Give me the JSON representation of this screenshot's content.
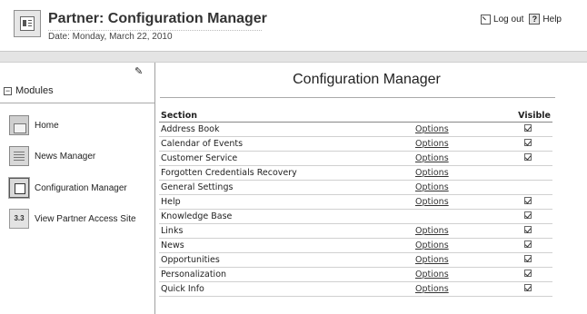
{
  "header": {
    "app_title": "Partner: Configuration Manager",
    "date": "Date: Monday, March 22, 2010",
    "logout_label": "Log out",
    "help_label": "Help"
  },
  "sidebar": {
    "modules_label": "Modules",
    "items": [
      {
        "label": "Home",
        "icon": "home-icon"
      },
      {
        "label": "News Manager",
        "icon": "news-manager-icon"
      },
      {
        "label": "Configuration Manager",
        "icon": "configuration-manager-icon"
      },
      {
        "label": "View Partner Access Site",
        "icon": "partner-site-icon"
      }
    ]
  },
  "main": {
    "title": "Configuration Manager",
    "columns": {
      "section": "Section",
      "visible": "Visible"
    },
    "rows": [
      {
        "section": "Address Book",
        "options": "Options",
        "visible": true
      },
      {
        "section": "Calendar of Events",
        "options": "Options",
        "visible": true
      },
      {
        "section": "Customer Service",
        "options": "Options",
        "visible": true
      },
      {
        "section": "Forgotten Credentials Recovery",
        "options": "Options",
        "visible": false
      },
      {
        "section": "General Settings",
        "options": "Options",
        "visible": false
      },
      {
        "section": "Help",
        "options": "Options",
        "visible": true
      },
      {
        "section": "Knowledge Base",
        "options": "",
        "visible": true
      },
      {
        "section": "Links",
        "options": "Options",
        "visible": true
      },
      {
        "section": "News",
        "options": "Options",
        "visible": true
      },
      {
        "section": "Opportunities",
        "options": "Options",
        "visible": true
      },
      {
        "section": "Personalization",
        "options": "Options",
        "visible": true
      },
      {
        "section": "Quick Info",
        "options": "Options",
        "visible": true
      }
    ]
  }
}
